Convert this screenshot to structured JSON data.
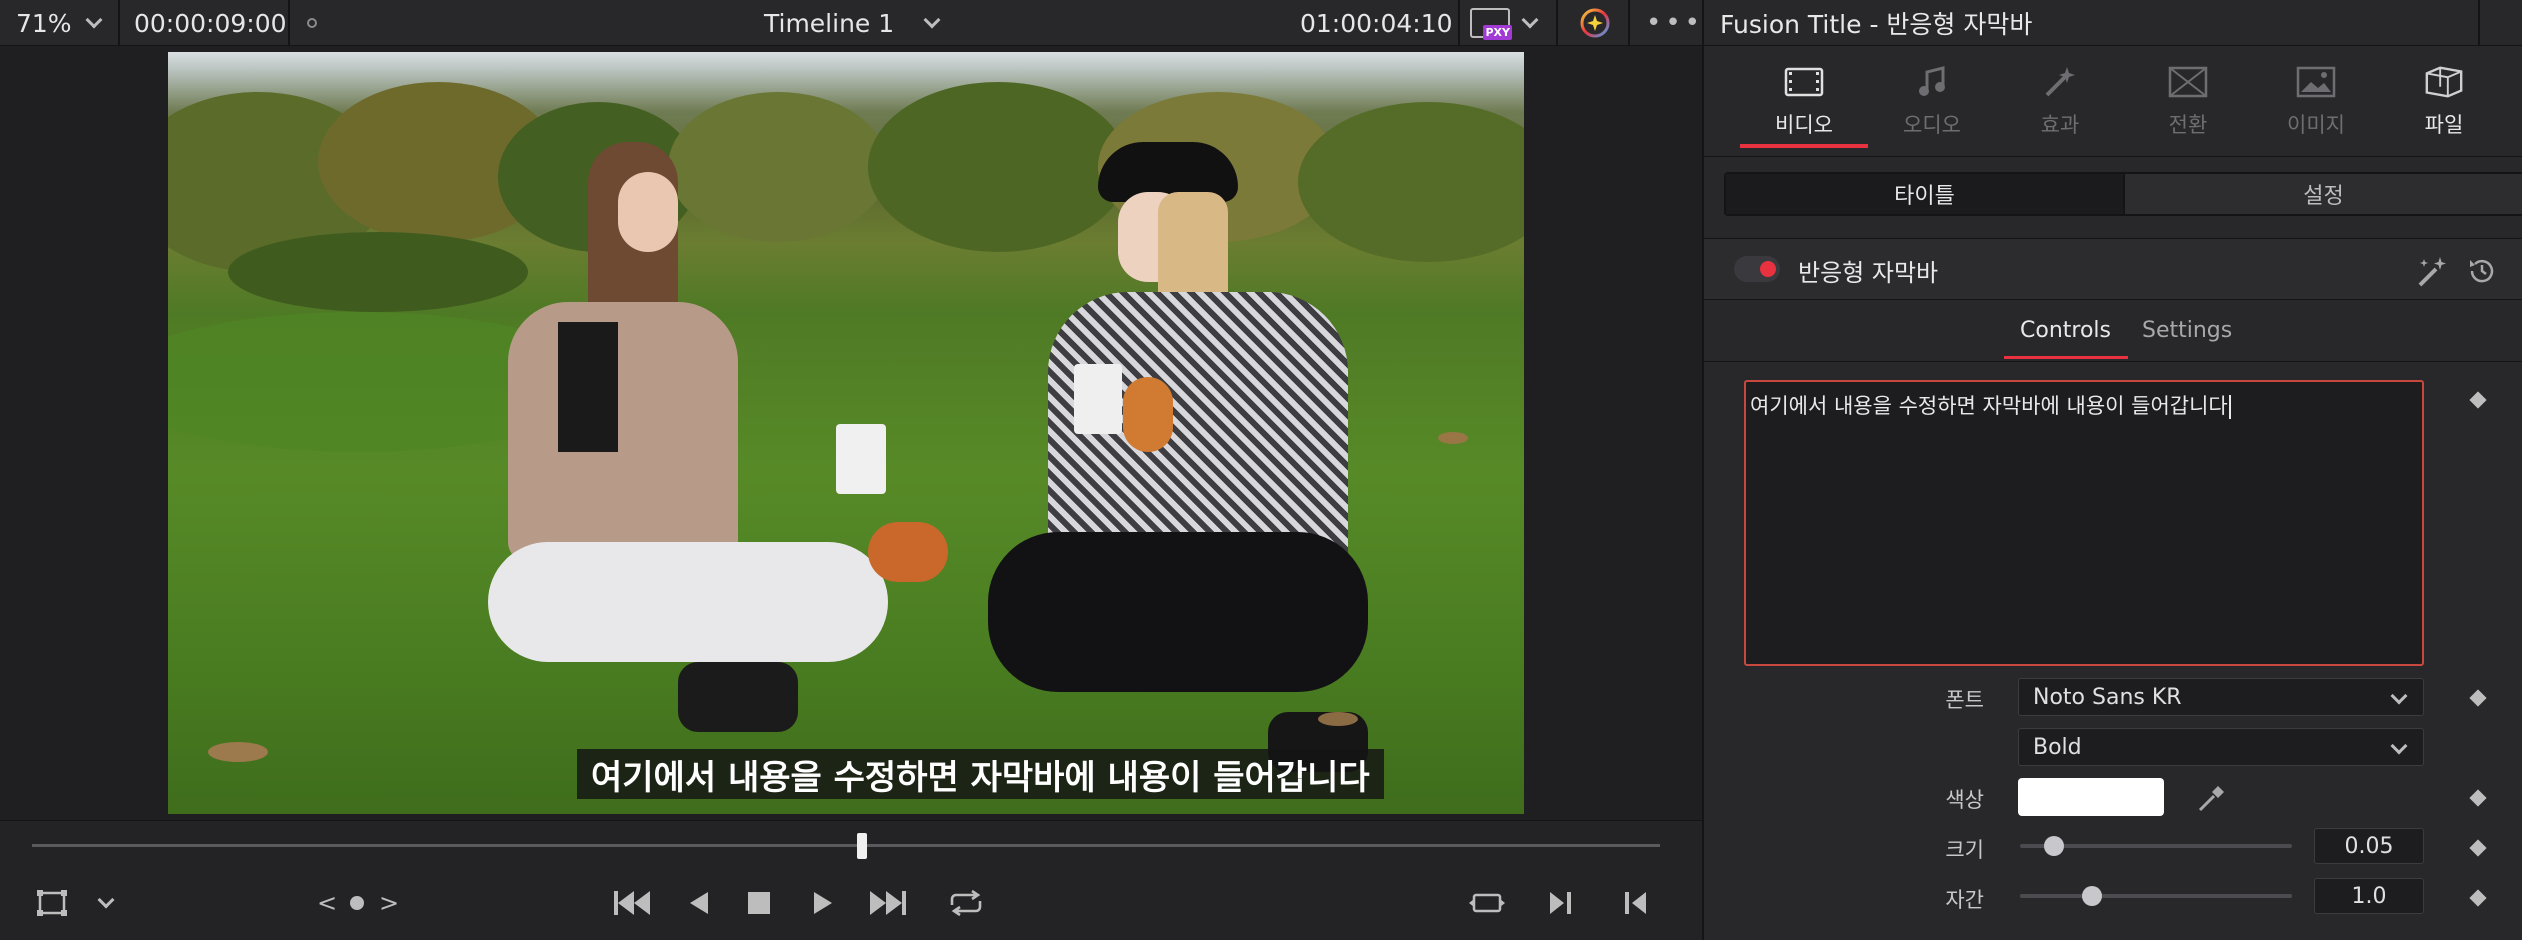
{
  "viewer": {
    "zoom": "71%",
    "timecode_left": "00:00:09:00",
    "timeline_name": "Timeline 1",
    "timecode_right": "01:00:04:10",
    "proxy_badge": "PXY",
    "subtitle_text": "여기에서 내용을 수정하면 자막바에 내용이 들어갑니다",
    "playhead_fraction": 0.51
  },
  "inspector": {
    "title": "Fusion Title - 반응형 자막바",
    "tabs": [
      {
        "label": "비디오",
        "icon": "film-icon",
        "active": true
      },
      {
        "label": "오디오",
        "icon": "music-note-icon",
        "active": false
      },
      {
        "label": "효과",
        "icon": "magic-wand-icon",
        "active": false
      },
      {
        "label": "전환",
        "icon": "transition-icon",
        "active": false
      },
      {
        "label": "이미지",
        "icon": "image-icon",
        "active": false
      },
      {
        "label": "파일",
        "icon": "file-icon",
        "active": true
      }
    ],
    "segments": {
      "title": "타이틀",
      "settings": "설정"
    },
    "effect_name": "반응형 자막바",
    "sub_tabs": {
      "controls": "Controls",
      "settings": "Settings"
    },
    "text_value": "여기에서 내용을 수정하면 자막바에 내용이 들어갑니다",
    "font_label": "폰트",
    "font_family": "Noto Sans KR",
    "font_style": "Bold",
    "color_label": "색상",
    "color_value": "#ffffff",
    "size_label": "크기",
    "size_value": "0.05",
    "size_fraction": 0.05,
    "tracking_label": "자간",
    "tracking_value": "1.0",
    "tracking_fraction": 0.2
  },
  "colors": {
    "accent": "#e8323f",
    "panel": "#28282b",
    "viewer_bg": "#1f1f21"
  }
}
